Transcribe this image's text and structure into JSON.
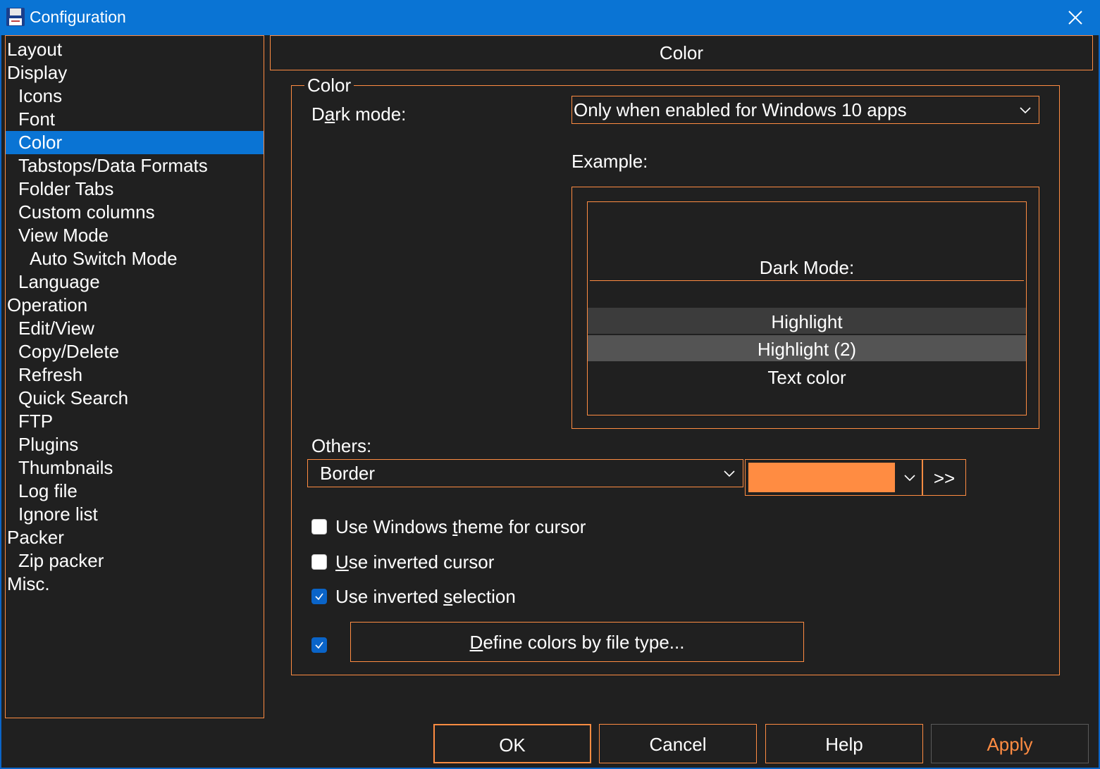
{
  "window": {
    "title": "Configuration",
    "app_icon": "floppy-disk-icon",
    "close_icon": "close-icon"
  },
  "colors": {
    "accent_border": "#ff8c42",
    "selection": "#0a74d4",
    "background": "#202020",
    "swatch": "#ff8c42",
    "apply_text": "#ff8c42"
  },
  "tree": [
    {
      "label": "Layout",
      "level": 0
    },
    {
      "label": "Display",
      "level": 0
    },
    {
      "label": "Icons",
      "level": 1
    },
    {
      "label": "Font",
      "level": 1
    },
    {
      "label": "Color",
      "level": 1,
      "selected": true
    },
    {
      "label": "Tabstops/Data Formats",
      "level": 1
    },
    {
      "label": "Folder Tabs",
      "level": 1
    },
    {
      "label": "Custom columns",
      "level": 1
    },
    {
      "label": "View Mode",
      "level": 1
    },
    {
      "label": "Auto Switch Mode",
      "level": 2
    },
    {
      "label": "Language",
      "level": 1
    },
    {
      "label": "Operation",
      "level": 0
    },
    {
      "label": "Edit/View",
      "level": 1
    },
    {
      "label": "Copy/Delete",
      "level": 1
    },
    {
      "label": "Refresh",
      "level": 1
    },
    {
      "label": "Quick Search",
      "level": 1
    },
    {
      "label": "FTP",
      "level": 1
    },
    {
      "label": "Plugins",
      "level": 1
    },
    {
      "label": "Thumbnails",
      "level": 1
    },
    {
      "label": "Log file",
      "level": 1
    },
    {
      "label": "Ignore list",
      "level": 1
    },
    {
      "label": "Packer",
      "level": 0
    },
    {
      "label": "Zip packer",
      "level": 1
    },
    {
      "label": "Misc.",
      "level": 0
    }
  ],
  "page": {
    "header": "Color",
    "group_title": "Color",
    "dark_mode": {
      "label_pre": "D",
      "label_u": "a",
      "label_post": "rk mode:",
      "value": "Only when enabled for Windows 10 apps"
    },
    "example": {
      "label": "Example:",
      "dark_mode_text": "Dark Mode:",
      "highlight": "Highlight",
      "highlight2": "Highlight (2)",
      "text_color": "Text color"
    },
    "others": {
      "label": "Others:",
      "value": "Border",
      "more_button": ">>"
    },
    "checkboxes": [
      {
        "pre": "Use Windows ",
        "u": "t",
        "post": "heme for cursor",
        "checked": false
      },
      {
        "pre": "",
        "u": "U",
        "post": "se inverted cursor",
        "checked": false
      },
      {
        "pre": "Use inverted ",
        "u": "s",
        "post": "election",
        "checked": true
      }
    ],
    "define_colors": {
      "checked": true,
      "pre": "",
      "u": "D",
      "post": "efine colors by file type..."
    }
  },
  "buttons": {
    "ok": "OK",
    "cancel": "Cancel",
    "help": "Help",
    "apply": "Apply"
  }
}
